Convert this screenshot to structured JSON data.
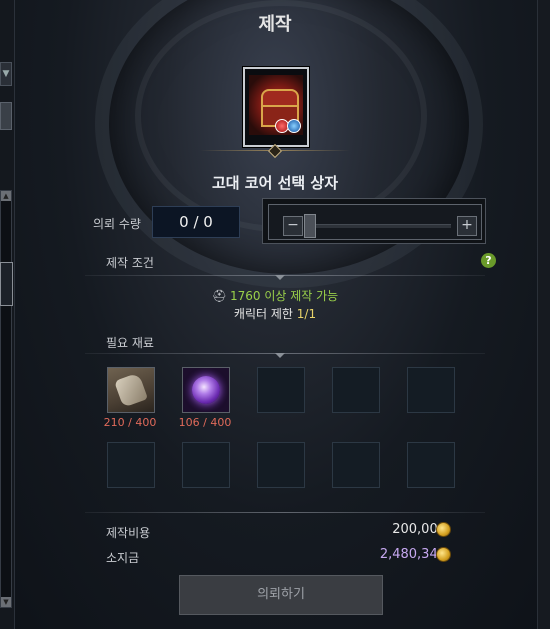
{
  "window": {
    "title": "제작"
  },
  "item": {
    "name": "고대 코어 선택 상자",
    "icon": "treasure-chest-icon"
  },
  "quantity": {
    "label": "의뢰 수량",
    "value": "0 / 0",
    "minus": "−",
    "plus": "+"
  },
  "conditions": {
    "label": "제작 조건",
    "level_text": "1760 이상 제작 가능",
    "char_limit_prefix": "캐릭터 제한 ",
    "char_limit_value": "1/1",
    "help": "?"
  },
  "materials": {
    "label": "필요 재료",
    "items": [
      {
        "icon": "ore-bag-icon",
        "count": "210 / 400"
      },
      {
        "icon": "purple-orb-icon",
        "count": "106 / 400"
      }
    ]
  },
  "cost": {
    "label": "제작비용",
    "value": "200,000",
    "owned_label": "소지금",
    "owned_value": "2,480,342",
    "value_color": "#e8e8e8",
    "owned_color": "#c6a8f0"
  },
  "actions": {
    "request": "의뢰하기"
  },
  "colors": {
    "accent_green": "#9ad04a",
    "count_red": "#e06a5a",
    "gold": "#e8d36a"
  }
}
